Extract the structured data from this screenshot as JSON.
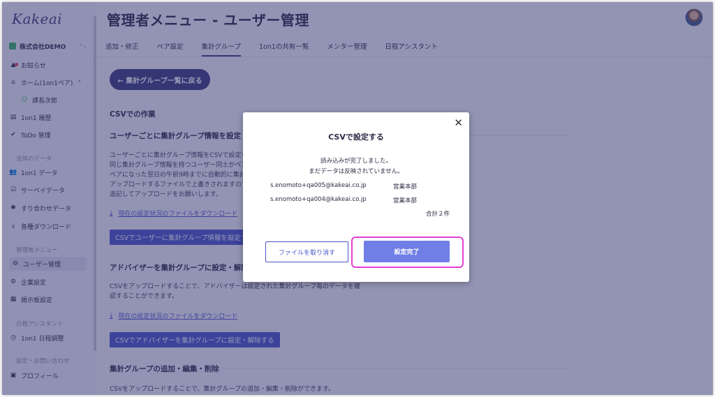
{
  "app": {
    "logo": "Kakeai"
  },
  "sidebar": {
    "company": "株式会社DEMO",
    "company_toggle": "⌃⌄",
    "items": [
      {
        "label": "お知らせ",
        "icon": "bell-icon",
        "glyph": "🔔"
      },
      {
        "label": "ホーム(1on1ペア)",
        "icon": "home-icon",
        "glyph": "⌂"
      },
      {
        "label": "課長次郎",
        "icon": "user-circle-icon",
        "glyph": "☺"
      },
      {
        "label": "1on1 履歴",
        "icon": "history-icon",
        "glyph": "▤"
      },
      {
        "label": "ToDo 管理",
        "icon": "check-circle-icon",
        "glyph": "✔"
      }
    ],
    "section_data": "全体のデータ",
    "data_items": [
      {
        "label": "1on1 データ",
        "glyph": "👥"
      },
      {
        "label": "サーベイデータ",
        "glyph": "☑"
      },
      {
        "label": "すり合わせデータ",
        "glyph": "✱"
      },
      {
        "label": "各種ダウンロード",
        "glyph": "⤓"
      }
    ],
    "section_admin": "管理者メニュー",
    "admin_items": [
      {
        "label": "ユーザー管理",
        "glyph": "⚙"
      },
      {
        "label": "企業設定",
        "glyph": "⚙"
      },
      {
        "label": "掲示板設定",
        "glyph": "▦"
      }
    ],
    "section_schedule": "日程アシスタント",
    "schedule_items": [
      {
        "label": "1on1 日程調整",
        "glyph": "◷"
      }
    ],
    "section_settings": "設定・お問い合わせ",
    "settings_items": [
      {
        "label": "プロフィール",
        "glyph": "▣"
      }
    ]
  },
  "header": {
    "title": "管理者メニュー - ユーザー管理",
    "tabs": [
      {
        "label": "追加・修正"
      },
      {
        "label": "ペア設定"
      },
      {
        "label": "集計グループ",
        "active": true
      },
      {
        "label": "1on1の共有一覧"
      },
      {
        "label": "メンター管理"
      },
      {
        "label": "日程アシスタント"
      }
    ]
  },
  "main": {
    "back_button": "← 集計グループ一覧に戻る",
    "csv_heading": "CSVでの作業",
    "user_heading": "ユーザーごとに集計グループ情報を設定",
    "user_para": "ユーザーごとに集計グループ情報をCSVで設定し 同じ集計グループ情報を持つユーザー同士がペア ペアになった翌日の午前9時までに自動的に集計 アップロードするファイルで上書きされますので 追記してアップロードをお願いします。",
    "download_link": "現在の設定状況のファイルをダウンロード",
    "user_button": "CSVでユーザーに集計グループ情報を設定する",
    "adv_heading": "アドバイザーを集計グループに設定・解除",
    "adv_para": "CSVをアップロードすることで、アドバイザーは設定された集計グループ毎のデータを確認することができます。",
    "download_link2": "現在の設定状況のファイルをダウンロード",
    "adv_button": "CSVでアドバイザーを集計グループに設定・解除する",
    "group_heading": "集計グループの追加・編集・削除",
    "group_para": "CSVをアップロードすることで、集計グループの追加・編集・削除ができます。"
  },
  "modal": {
    "title": "CSVで設定する",
    "message1": "読み込みが完了しました。",
    "message2": "まだデータは反映されていません。",
    "rows": [
      {
        "email": "s.enomoto+qa005@kakeai.co.jp",
        "dept": "営業本部"
      },
      {
        "email": "s.enomoto+qa004@kakeai.co.jp",
        "dept": "営業本部"
      }
    ],
    "total": "合計２件",
    "cancel_button": "ファイルを取り消す",
    "confirm_button": "設定完了",
    "close_glyph": "✕"
  },
  "colors": {
    "brand": "#3a3d7a",
    "accent": "#4a55c8",
    "confirm": "#6f7fe6",
    "highlight": "#e23fd0",
    "notification": "#e0384a"
  }
}
